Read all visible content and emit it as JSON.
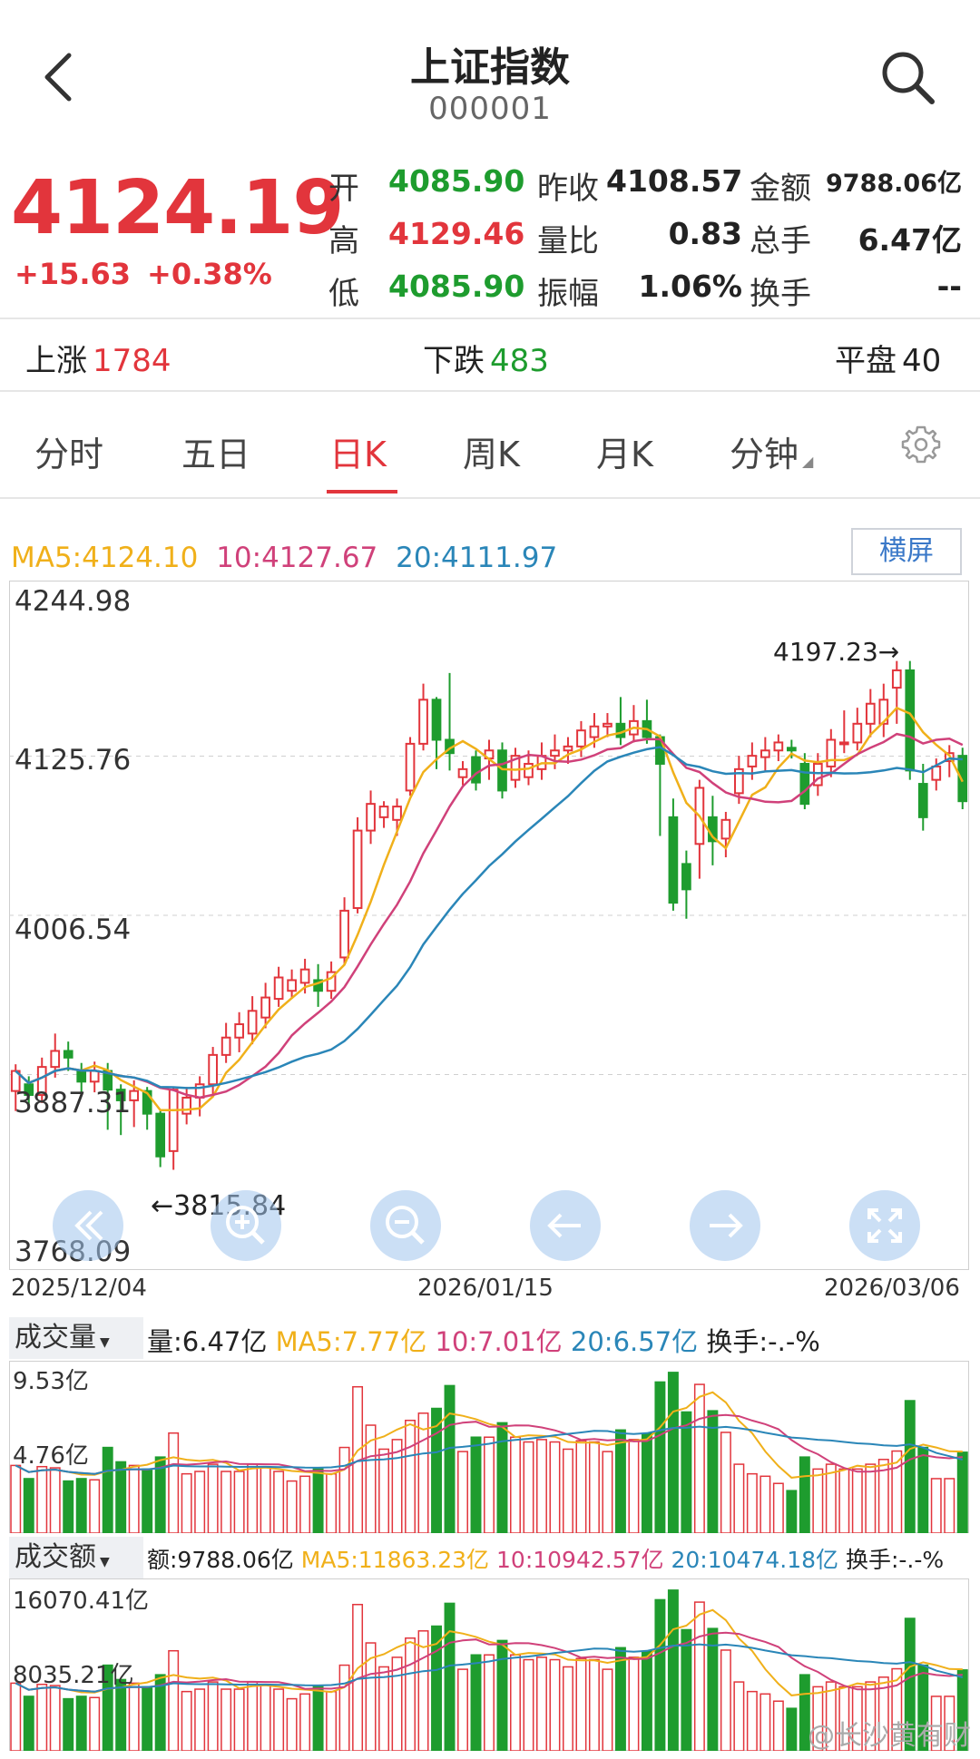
{
  "header": {
    "title": "上证指数",
    "code": "000001",
    "back_icon": "chevron-left-icon",
    "search_icon": "search-icon"
  },
  "quote": {
    "price": "4124.19",
    "change": "+15.63",
    "change_pct": "+0.38%",
    "stats": [
      {
        "label": "开",
        "value": "4085.90",
        "color": "green"
      },
      {
        "label": "昨收",
        "value": "4108.57",
        "color": "black"
      },
      {
        "label": "金额",
        "value": "9788.06亿",
        "color": "black"
      },
      {
        "label": "高",
        "value": "4129.46",
        "color": "red"
      },
      {
        "label": "量比",
        "value": "0.83",
        "color": "black"
      },
      {
        "label": "总手",
        "value": "6.47亿",
        "color": "black"
      },
      {
        "label": "低",
        "value": "4085.90",
        "color": "green"
      },
      {
        "label": "振幅",
        "value": "1.06%",
        "color": "black"
      },
      {
        "label": "换手",
        "value": "--",
        "color": "black"
      }
    ]
  },
  "breadth": {
    "up_label": "上涨",
    "up_value": "1784",
    "down_label": "下跌",
    "down_value": "483",
    "flat_label": "平盘",
    "flat_value": "40"
  },
  "tabs": [
    "分时",
    "五日",
    "日K",
    "周K",
    "月K",
    "分钟"
  ],
  "active_tab": "日K",
  "settings_icon": "gear-icon",
  "chart_legend": {
    "ma5": "MA5:4124.10",
    "ma10": "10:4127.67",
    "ma20": "20:4111.97",
    "landscape_button": "横屏"
  },
  "colors": {
    "up": "#e2353c",
    "down": "#1e9c2e",
    "ma5": "#f0b01a",
    "ma10": "#d0417a",
    "ma20": "#2a86b8"
  },
  "nav_icons": [
    "rewind-icon",
    "zoom-in-icon",
    "zoom-out-icon",
    "arrow-left-icon",
    "arrow-right-icon",
    "fullscreen-icon"
  ],
  "chart_data": {
    "type": "candlestick",
    "price_axis_labels": [
      "4244.98",
      "4125.76",
      "4006.54",
      "3887.31",
      "3768.09"
    ],
    "ylim": [
      3768.09,
      4244.98
    ],
    "date_labels": [
      "2025/12/04",
      "2026/01/15",
      "2026/03/06"
    ],
    "high_annotation": "4197.23→",
    "low_annotation": "←3815.84",
    "candles": [
      [
        3875,
        3890,
        3860,
        3895
      ],
      [
        3880,
        3872,
        3862,
        3886
      ],
      [
        3872,
        3893,
        3866,
        3900
      ],
      [
        3893,
        3905,
        3885,
        3918
      ],
      [
        3905,
        3900,
        3890,
        3912
      ],
      [
        3890,
        3882,
        3872,
        3896
      ],
      [
        3882,
        3890,
        3874,
        3897
      ],
      [
        3890,
        3876,
        3846,
        3896
      ],
      [
        3876,
        3868,
        3842,
        3880
      ],
      [
        3868,
        3875,
        3848,
        3883
      ],
      [
        3875,
        3858,
        3846,
        3878
      ],
      [
        3858,
        3826,
        3818,
        3860
      ],
      [
        3830,
        3876,
        3816,
        3878
      ],
      [
        3858,
        3870,
        3850,
        3878
      ],
      [
        3870,
        3880,
        3856,
        3886
      ],
      [
        3880,
        3902,
        3872,
        3908
      ],
      [
        3902,
        3915,
        3896,
        3926
      ],
      [
        3915,
        3925,
        3904,
        3934
      ],
      [
        3918,
        3935,
        3910,
        3946
      ],
      [
        3930,
        3945,
        3922,
        3956
      ],
      [
        3944,
        3960,
        3938,
        3968
      ],
      [
        3950,
        3958,
        3944,
        3966
      ],
      [
        3956,
        3966,
        3948,
        3974
      ],
      [
        3958,
        3950,
        3938,
        3970
      ],
      [
        3950,
        3964,
        3944,
        3972
      ],
      [
        3975,
        4010,
        3970,
        4020
      ],
      [
        4012,
        4070,
        4008,
        4080
      ],
      [
        4070,
        4090,
        4060,
        4100
      ],
      [
        4080,
        4088,
        4072,
        4092
      ],
      [
        4078,
        4088,
        4066,
        4094
      ],
      [
        4100,
        4135,
        4096,
        4140
      ],
      [
        4135,
        4168,
        4130,
        4180
      ],
      [
        4168,
        4138,
        4116,
        4170
      ],
      [
        4138,
        4128,
        4115,
        4188
      ],
      [
        4110,
        4116,
        4104,
        4122
      ],
      [
        4125,
        4106,
        4100,
        4130
      ],
      [
        4124,
        4130,
        4108,
        4138
      ],
      [
        4130,
        4100,
        4094,
        4136
      ],
      [
        4108,
        4126,
        4102,
        4132
      ],
      [
        4110,
        4120,
        4104,
        4130
      ],
      [
        4116,
        4126,
        4108,
        4136
      ],
      [
        4126,
        4130,
        4116,
        4142
      ],
      [
        4130,
        4133,
        4120,
        4140
      ],
      [
        4133,
        4145,
        4125,
        4152
      ],
      [
        4140,
        4148,
        4132,
        4158
      ],
      [
        4148,
        4150,
        4140,
        4158
      ],
      [
        4150,
        4140,
        4134,
        4170
      ],
      [
        4142,
        4152,
        4136,
        4164
      ],
      [
        4152,
        4140,
        4135,
        4168
      ],
      [
        4140,
        4120,
        4066,
        4142
      ],
      [
        4080,
        4016,
        4010,
        4094
      ],
      [
        4045,
        4026,
        4004,
        4055
      ],
      [
        4060,
        4102,
        4034,
        4108
      ],
      [
        4080,
        4062,
        4044,
        4096
      ],
      [
        4064,
        4078,
        4050,
        4084
      ],
      [
        4098,
        4116,
        4090,
        4126
      ],
      [
        4118,
        4126,
        4108,
        4136
      ],
      [
        4125,
        4130,
        4114,
        4140
      ],
      [
        4130,
        4136,
        4122,
        4142
      ],
      [
        4132,
        4130,
        4124,
        4138
      ],
      [
        4120,
        4090,
        4086,
        4128
      ],
      [
        4104,
        4120,
        4096,
        4128
      ],
      [
        4118,
        4138,
        4110,
        4146
      ],
      [
        4136,
        4136,
        4128,
        4160
      ],
      [
        4136,
        4150,
        4130,
        4162
      ],
      [
        4150,
        4165,
        4140,
        4176
      ],
      [
        4150,
        4168,
        4140,
        4180
      ],
      [
        4177,
        4190,
        4150,
        4197
      ],
      [
        4190,
        4115,
        4108,
        4197
      ],
      [
        4105,
        4080,
        4070,
        4120
      ],
      [
        4108,
        4118,
        4100,
        4124
      ],
      [
        4122,
        4128,
        4110,
        4134
      ],
      [
        4126,
        4092,
        4086,
        4132
      ]
    ],
    "volume_legend": {
      "dropdown": "成交量",
      "vol": "量:6.47亿",
      "ma5": "MA5:7.77亿",
      "ma10": "10:7.01亿",
      "ma20": "20:6.57亿",
      "turnover": "换手:-.-%",
      "top": "9.53亿",
      "mid": "4.76亿"
    },
    "amount_legend": {
      "dropdown": "成交额",
      "amt": "额:9788.06亿",
      "ma5": "MA5:11863.23亿",
      "ma10": "10:10942.57亿",
      "ma20": "20:10474.18亿",
      "turnover": "换手:-.-%",
      "top": "16070.41亿",
      "mid": "8035.21亿"
    }
  },
  "watermark": "@长沙黄有财"
}
